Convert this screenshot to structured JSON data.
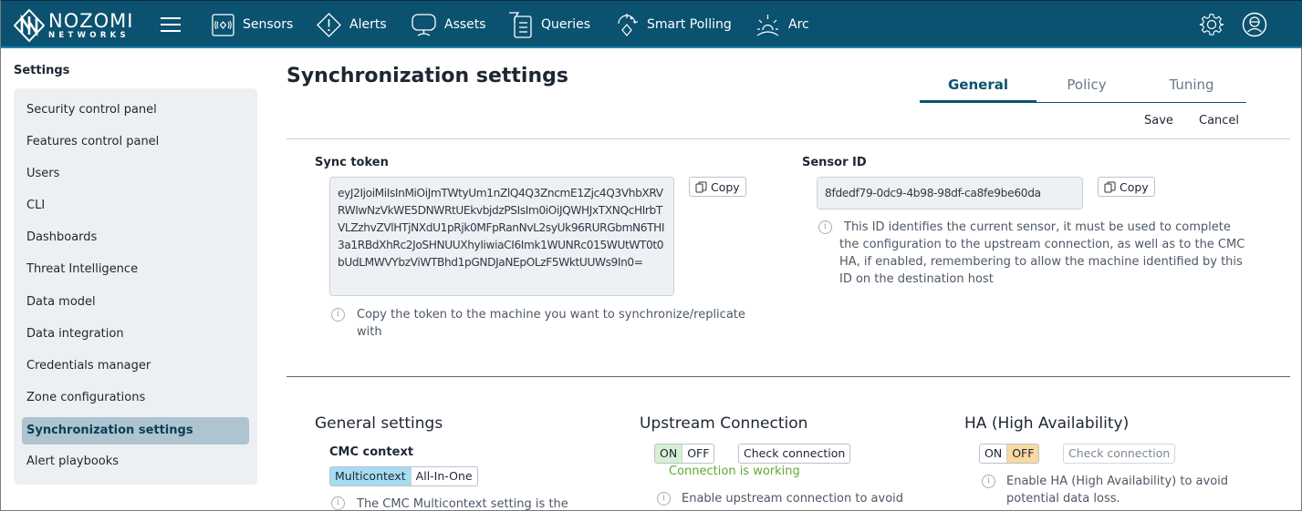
{
  "brand": {
    "name": "NOZOMI",
    "sub": "NETWORKS"
  },
  "nav": {
    "items": [
      {
        "label": "Sensors",
        "icon": "sensors-icon"
      },
      {
        "label": "Alerts",
        "icon": "alert-diamond-icon"
      },
      {
        "label": "Assets",
        "icon": "monitor-icon"
      },
      {
        "label": "Queries",
        "icon": "filter-list-icon"
      },
      {
        "label": "Smart Polling",
        "icon": "smart-polling-icon"
      },
      {
        "label": "Arc",
        "icon": "arc-sunrise-icon"
      }
    ],
    "right_icons": [
      "gear-icon",
      "user-avatar-icon"
    ]
  },
  "sidebar": {
    "title": "Settings",
    "items": [
      {
        "label": "Security control panel",
        "active": false
      },
      {
        "label": "Features control panel",
        "active": false
      },
      {
        "label": "Users",
        "active": false
      },
      {
        "label": "CLI",
        "active": false
      },
      {
        "label": "Dashboards",
        "active": false
      },
      {
        "label": "Threat Intelligence",
        "active": false
      },
      {
        "label": "Data model",
        "active": false
      },
      {
        "label": "Data integration",
        "active": false
      },
      {
        "label": "Credentials manager",
        "active": false
      },
      {
        "label": "Zone configurations",
        "active": false
      },
      {
        "label": "Synchronization settings",
        "active": true
      },
      {
        "label": "Alert playbooks",
        "active": false
      }
    ]
  },
  "main": {
    "title": "Synchronization settings",
    "tabs": [
      {
        "label": "General",
        "active": true
      },
      {
        "label": "Policy",
        "active": false
      },
      {
        "label": "Tuning",
        "active": false
      }
    ],
    "actions": {
      "save": "Save",
      "cancel": "Cancel"
    },
    "sync_token": {
      "label": "Sync token",
      "value": "eyJ2IjoiMiIsInMiOiJmTWtyUm1nZlQ4Q3ZncmE1Zjc4Q3VhbXRVRWIwNzVkWE5DNWRtUEkvbjdzPSIsIm0iOiJQWHJxTXNQcHIrbTVLZzhvZVlHTjNXdU1pRjk0MFpRanNvL2syUk96RURGbmN6THI3a1RBdXhRc2JoSHNUUXhyIiwiaCI6Imk1WUNRc015WUtWT0t0bUdLMWVYbzViWTBhd1pGNDJaNEpOLzF5WktUUWs9In0=",
      "copy_label": "Copy",
      "info": "Copy the token to the machine you want to synchronize/replicate with"
    },
    "sensor_id": {
      "label": "Sensor ID",
      "value": "8fdedf79-0dc9-4b98-98df-ca8fe9be60da",
      "copy_label": "Copy",
      "info": "This ID identifies the current sensor, it must be used to complete the configuration to the upstream connection, as well as to the CMC HA, if enabled, remembering to allow the machine identified by this ID on the destination host"
    },
    "general_settings": {
      "title": "General settings",
      "cmc_context": {
        "label": "CMC context",
        "options": [
          "Multicontext",
          "All-In-One"
        ],
        "selected": "Multicontext",
        "info": "The CMC Multicontext setting is the"
      }
    },
    "upstream": {
      "title": "Upstream Connection",
      "toggle": {
        "on": "ON",
        "off": "OFF",
        "state": "ON"
      },
      "check_label": "Check connection",
      "status": "Connection is working",
      "status_color": "#5cab2f",
      "info": "Enable upstream connection to avoid"
    },
    "ha": {
      "title": "HA (High Availability)",
      "toggle": {
        "on": "ON",
        "off": "OFF",
        "state": "OFF"
      },
      "check_label": "Check connection",
      "info": "Enable HA (High Availability) to avoid potential data loss."
    }
  },
  "colors": {
    "topbar": "#0b5270",
    "accent": "#0b5270",
    "sidebar_bg": "#edf0f3",
    "sidebar_active": "#aec4d0",
    "toggle_multicontext": "#a6dcf2",
    "toggle_on": "#d6f0d2",
    "toggle_off": "#f9d9a0"
  }
}
